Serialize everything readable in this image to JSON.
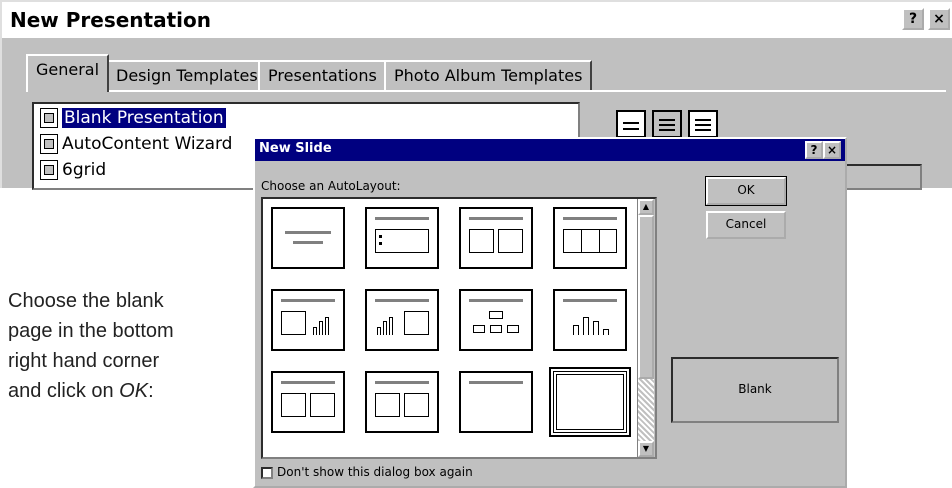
{
  "main_window": {
    "title": "New Presentation",
    "help_label": "?",
    "close_label": "×",
    "tabs": [
      {
        "label": "General"
      },
      {
        "label": "Design Templates"
      },
      {
        "label": "Presentations"
      },
      {
        "label": "Photo Album Templates"
      }
    ],
    "list_items": [
      {
        "label": "Blank Presentation"
      },
      {
        "label": "AutoContent Wizard"
      },
      {
        "label": "6grid"
      }
    ]
  },
  "dialog": {
    "title": "New Slide",
    "help_label": "?",
    "close_label": "×",
    "choose_label": "Choose an AutoLayout:",
    "ok_label": "OK",
    "cancel_label": "Cancel",
    "selected_layout_name": "Blank",
    "checkbox_label": "Don't show this dialog box again",
    "checkbox_checked": false
  },
  "instruction": {
    "line1": "Choose the blank",
    "line2": "page in the bottom",
    "line3": "right hand corner",
    "line4_prefix": "and click on ",
    "line4_em": "OK",
    "line4_suffix": ":"
  }
}
